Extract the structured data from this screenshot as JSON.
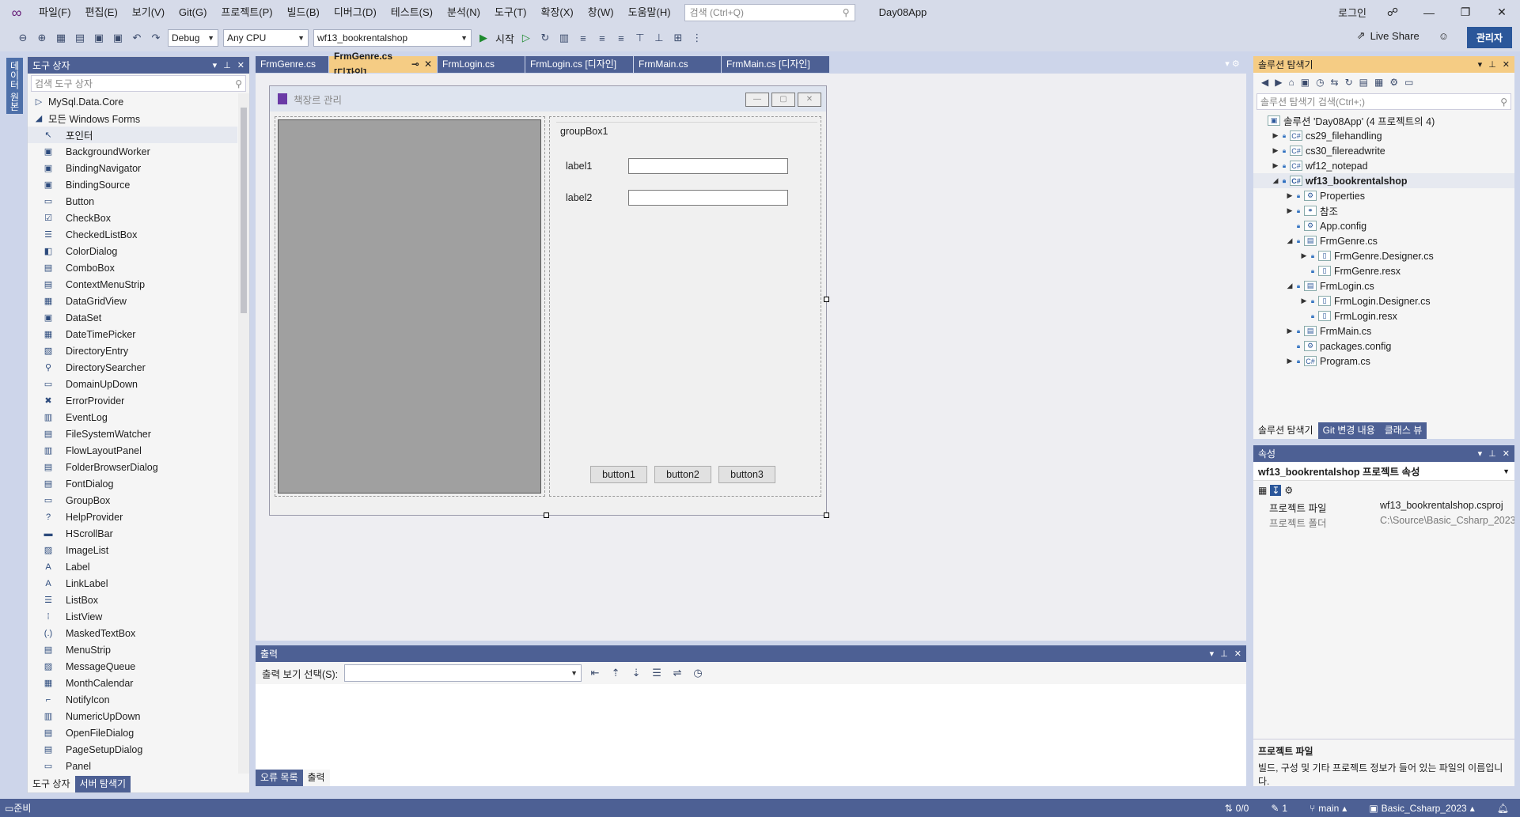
{
  "titlebar": {
    "menu": [
      "파일(F)",
      "편집(E)",
      "보기(V)",
      "Git(G)",
      "프로젝트(P)",
      "빌드(B)",
      "디버그(D)",
      "테스트(S)",
      "분석(N)",
      "도구(T)",
      "확장(X)",
      "창(W)",
      "도움말(H)"
    ],
    "search_placeholder": "검색 (Ctrl+Q)",
    "app_name": "Day08App",
    "login": "로그인"
  },
  "toolbar": {
    "config": "Debug",
    "platform": "Any CPU",
    "project": "wf13_bookrentalshop",
    "start": "시작",
    "live_share": "Live Share",
    "admin": "관리자"
  },
  "vstrip": {
    "label": "데이터 원본"
  },
  "toolbox": {
    "title": "도구 상자",
    "search_placeholder": "검색 도구 상자",
    "groups": [
      {
        "label": "MySql.Data.Core",
        "expanded": false
      },
      {
        "label": "모든 Windows Forms",
        "expanded": true
      }
    ],
    "items": [
      {
        "label": "포인터",
        "icon": "pointer-icon",
        "glyph": "↖"
      },
      {
        "label": "BackgroundWorker",
        "icon": "component-icon",
        "glyph": "▣"
      },
      {
        "label": "BindingNavigator",
        "icon": "component-icon",
        "glyph": "▣"
      },
      {
        "label": "BindingSource",
        "icon": "component-icon",
        "glyph": "▣"
      },
      {
        "label": "Button",
        "icon": "button-icon",
        "glyph": "▭"
      },
      {
        "label": "CheckBox",
        "icon": "checkbox-icon",
        "glyph": "☑"
      },
      {
        "label": "CheckedListBox",
        "icon": "list-icon",
        "glyph": "☰"
      },
      {
        "label": "ColorDialog",
        "icon": "dialog-icon",
        "glyph": "◧"
      },
      {
        "label": "ComboBox",
        "icon": "combo-icon",
        "glyph": "▤"
      },
      {
        "label": "ContextMenuStrip",
        "icon": "menu-icon",
        "glyph": "▤"
      },
      {
        "label": "DataGridView",
        "icon": "grid-icon",
        "glyph": "▦"
      },
      {
        "label": "DataSet",
        "icon": "dataset-icon",
        "glyph": "▣"
      },
      {
        "label": "DateTimePicker",
        "icon": "calendar-icon",
        "glyph": "▦"
      },
      {
        "label": "DirectoryEntry",
        "icon": "directory-icon",
        "glyph": "▧"
      },
      {
        "label": "DirectorySearcher",
        "icon": "search-icon",
        "glyph": "⚲"
      },
      {
        "label": "DomainUpDown",
        "icon": "updown-icon",
        "glyph": "▭"
      },
      {
        "label": "ErrorProvider",
        "icon": "error-icon",
        "glyph": "✖"
      },
      {
        "label": "EventLog",
        "icon": "log-icon",
        "glyph": "▥"
      },
      {
        "label": "FileSystemWatcher",
        "icon": "watcher-icon",
        "glyph": "▤"
      },
      {
        "label": "FlowLayoutPanel",
        "icon": "panel-icon",
        "glyph": "▥"
      },
      {
        "label": "FolderBrowserDialog",
        "icon": "folder-icon",
        "glyph": "▤"
      },
      {
        "label": "FontDialog",
        "icon": "font-icon",
        "glyph": "▤"
      },
      {
        "label": "GroupBox",
        "icon": "groupbox-icon",
        "glyph": "▭"
      },
      {
        "label": "HelpProvider",
        "icon": "help-icon",
        "glyph": "?"
      },
      {
        "label": "HScrollBar",
        "icon": "scrollbar-icon",
        "glyph": "▬"
      },
      {
        "label": "ImageList",
        "icon": "image-icon",
        "glyph": "▨"
      },
      {
        "label": "Label",
        "icon": "label-icon",
        "glyph": "A"
      },
      {
        "label": "LinkLabel",
        "icon": "linklabel-icon",
        "glyph": "A"
      },
      {
        "label": "ListBox",
        "icon": "listbox-icon",
        "glyph": "☰"
      },
      {
        "label": "ListView",
        "icon": "listview-icon",
        "glyph": "⁞"
      },
      {
        "label": "MaskedTextBox",
        "icon": "masked-icon",
        "glyph": "(.)"
      },
      {
        "label": "MenuStrip",
        "icon": "menustrip-icon",
        "glyph": "▤"
      },
      {
        "label": "MessageQueue",
        "icon": "queue-icon",
        "glyph": "▨"
      },
      {
        "label": "MonthCalendar",
        "icon": "calendar-icon",
        "glyph": "▦"
      },
      {
        "label": "NotifyIcon",
        "icon": "notify-icon",
        "glyph": "⌐"
      },
      {
        "label": "NumericUpDown",
        "icon": "numeric-icon",
        "glyph": "▥"
      },
      {
        "label": "OpenFileDialog",
        "icon": "openfile-icon",
        "glyph": "▤"
      },
      {
        "label": "PageSetupDialog",
        "icon": "pagesetup-icon",
        "glyph": "▤"
      },
      {
        "label": "Panel",
        "icon": "panel-icon",
        "glyph": "▭"
      }
    ],
    "bottom_tabs": [
      "도구 상자",
      "서버 탐색기"
    ]
  },
  "doc_tabs": [
    {
      "label": "FrmGenre.cs",
      "active": false
    },
    {
      "label": "FrmGenre.cs [디자인]",
      "active": true
    },
    {
      "label": "FrmLogin.cs",
      "active": false
    },
    {
      "label": "FrmLogin.cs [디자인]",
      "active": false
    },
    {
      "label": "FrmMain.cs",
      "active": false
    },
    {
      "label": "FrmMain.cs [디자인]",
      "active": false
    }
  ],
  "form": {
    "title": "책장르 관리",
    "groupbox": "groupBox1",
    "label1": "label1",
    "label2": "label2",
    "button1": "button1",
    "button2": "button2",
    "button3": "button3"
  },
  "output": {
    "title": "출력",
    "select_label": "출력 보기 선택(S):",
    "bottom_tabs": [
      "오류 목록",
      "출력"
    ]
  },
  "solution": {
    "title": "솔루션 탐색기",
    "search_placeholder": "솔루션 탐색기 검색(Ctrl+;)",
    "tree": [
      {
        "label": "솔루션 'Day08App' (4 프로젝트의 4)",
        "level": 0,
        "exp": "",
        "icon": "solution-icon",
        "glyph": "▣"
      },
      {
        "label": "cs29_filehandling",
        "level": 1,
        "exp": "▶",
        "icon": "csproj-icon",
        "glyph": "C#"
      },
      {
        "label": "cs30_filereadwrite",
        "level": 1,
        "exp": "▶",
        "icon": "csproj-icon",
        "glyph": "C#"
      },
      {
        "label": "wf12_notepad",
        "level": 1,
        "exp": "▶",
        "icon": "csproj-icon",
        "glyph": "C#"
      },
      {
        "label": "wf13_bookrentalshop",
        "level": 1,
        "exp": "◢",
        "icon": "csproj-icon",
        "glyph": "C#",
        "bold": true
      },
      {
        "label": "Properties",
        "level": 2,
        "exp": "▶",
        "icon": "wrench-icon",
        "glyph": "⚙"
      },
      {
        "label": "참조",
        "level": 2,
        "exp": "▶",
        "icon": "reference-icon",
        "glyph": "⚭"
      },
      {
        "label": "App.config",
        "level": 2,
        "exp": "",
        "icon": "config-icon",
        "glyph": "⚙"
      },
      {
        "label": "FrmGenre.cs",
        "level": 2,
        "exp": "◢",
        "icon": "form-icon",
        "glyph": "▤"
      },
      {
        "label": "FrmGenre.Designer.cs",
        "level": 3,
        "exp": "▶",
        "icon": "file-icon",
        "glyph": "▯"
      },
      {
        "label": "FrmGenre.resx",
        "level": 3,
        "exp": "",
        "icon": "file-icon",
        "glyph": "▯"
      },
      {
        "label": "FrmLogin.cs",
        "level": 2,
        "exp": "◢",
        "icon": "form-icon",
        "glyph": "▤"
      },
      {
        "label": "FrmLogin.Designer.cs",
        "level": 3,
        "exp": "▶",
        "icon": "file-icon",
        "glyph": "▯"
      },
      {
        "label": "FrmLogin.resx",
        "level": 3,
        "exp": "",
        "icon": "file-icon",
        "glyph": "▯"
      },
      {
        "label": "FrmMain.cs",
        "level": 2,
        "exp": "▶",
        "icon": "form-icon",
        "glyph": "▤"
      },
      {
        "label": "packages.config",
        "level": 2,
        "exp": "",
        "icon": "config-icon",
        "glyph": "⚙"
      },
      {
        "label": "Program.cs",
        "level": 2,
        "exp": "▶",
        "icon": "csharp-icon",
        "glyph": "C#"
      }
    ],
    "bottom_tabs": [
      "솔루션 탐색기",
      "Git 변경 내용",
      "클래스 뷰"
    ]
  },
  "properties": {
    "title": "속성",
    "selected_object": "wf13_bookrentalshop 프로젝트 속성",
    "rows": [
      {
        "key": "프로젝트 파일",
        "value": "wf13_bookrentalshop.csproj",
        "gray": false
      },
      {
        "key": "프로젝트 폴더",
        "value": "C:\\Source\\Basic_Csharp_2023",
        "gray": true
      }
    ],
    "desc_title": "프로젝트 파일",
    "desc_text": "빌드, 구성 및 기타 프로젝트 정보가 들어 있는 파일의 이름입니다."
  },
  "statusbar": {
    "ready": "준비",
    "changes": "0/0",
    "edits": "1",
    "branch": "main",
    "repo": "Basic_Csharp_2023"
  },
  "colors": {
    "accent": "#4d6094",
    "active_tab": "#f5cc84",
    "chrome": "#cdd5ea"
  }
}
